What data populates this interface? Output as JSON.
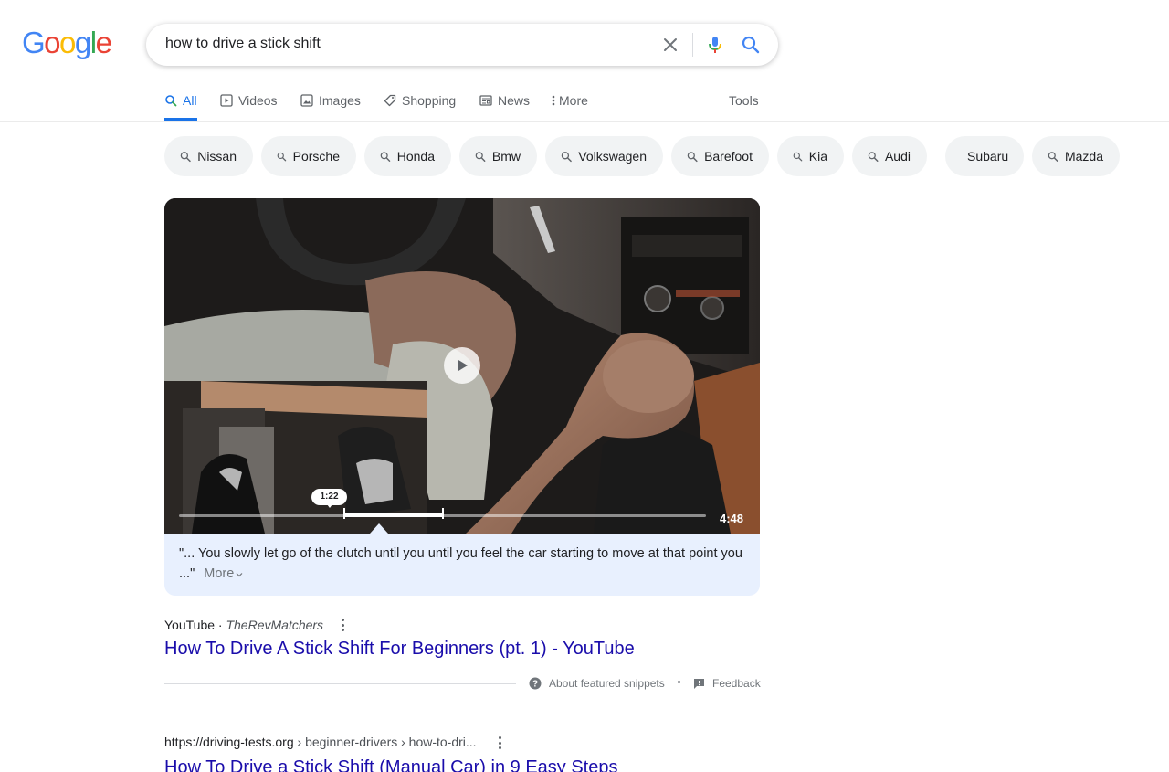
{
  "logo": {
    "letters": [
      "G",
      "o",
      "o",
      "g",
      "l",
      "e"
    ],
    "colors": [
      "#4285f4",
      "#ea4335",
      "#fbbc05",
      "#4285f4",
      "#34a853",
      "#ea4335"
    ]
  },
  "search": {
    "query": "how to drive a stick shift"
  },
  "tabs": [
    {
      "label": "All",
      "icon": "search-icon",
      "active": true
    },
    {
      "label": "Videos",
      "icon": "video-icon",
      "active": false
    },
    {
      "label": "Images",
      "icon": "image-icon",
      "active": false
    },
    {
      "label": "Shopping",
      "icon": "tag-icon",
      "active": false
    },
    {
      "label": "News",
      "icon": "news-icon",
      "active": false
    },
    {
      "label": "More",
      "icon": "more-vert-icon",
      "active": false
    }
  ],
  "tools_label": "Tools",
  "chips": [
    "Nissan",
    "Porsche",
    "Honda",
    "Bmw",
    "Volkswagen",
    "Barefoot",
    "Kia",
    "Audi",
    "Subaru",
    "Mazda"
  ],
  "video": {
    "current_time": "1:22",
    "duration": "4:48",
    "snippet_text": "\"... You slowly let go of the clutch until you until you feel the car starting to move at that point you ...\"",
    "more_label": "More"
  },
  "result1": {
    "site": "YouTube",
    "author": "TheRevMatchers",
    "title": "How To Drive A Stick Shift For Beginners (pt. 1) - YouTube"
  },
  "footer": {
    "about_label": "About featured snippets",
    "feedback_label": "Feedback"
  },
  "result2": {
    "url": "https://driving-tests.org",
    "breadcrumb": " › beginner-drivers › how-to-dri...",
    "title": "How To Drive a Stick Shift (Manual Car) in 9 Easy Steps"
  },
  "colors": {
    "link": "#1a0dab",
    "accent": "#1a73e8",
    "snippet_bg": "#e8f0fe"
  }
}
